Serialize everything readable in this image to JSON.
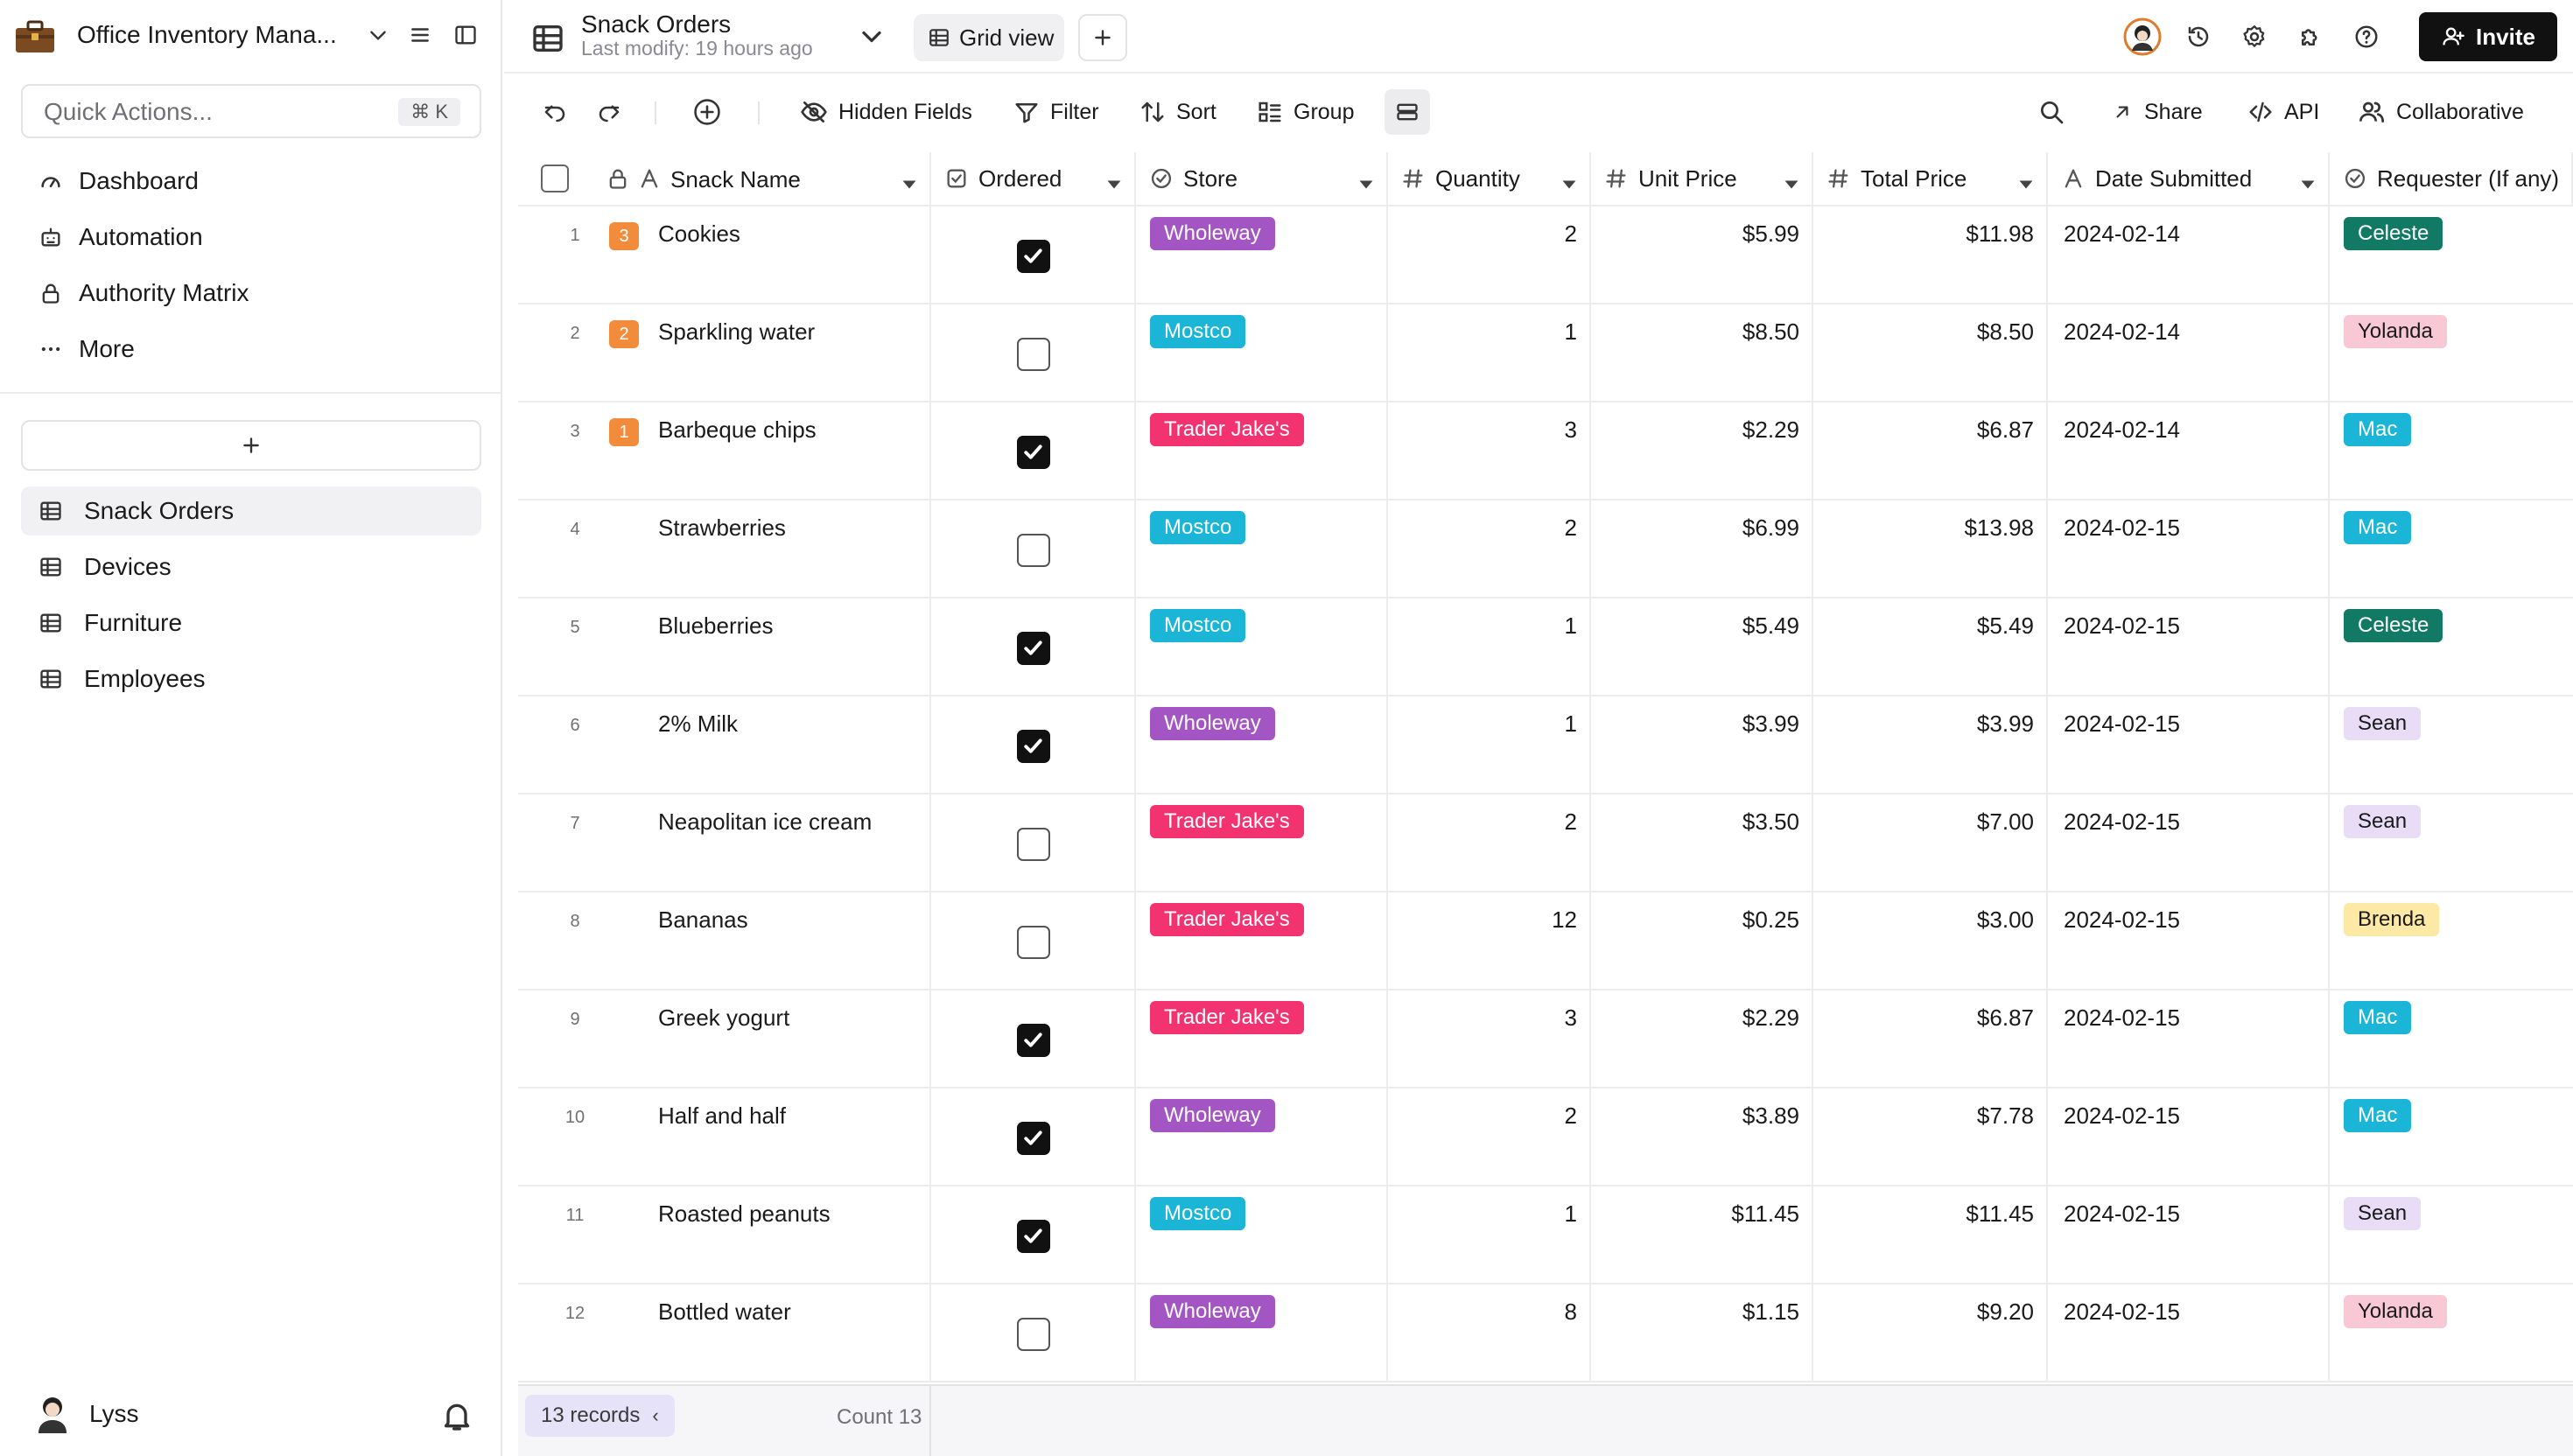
{
  "sidebar": {
    "app_title": "Office Inventory Mana...",
    "quick_actions": {
      "placeholder": "Quick Actions...",
      "shortcut": "⌘ K"
    },
    "nav": [
      {
        "label": "Dashboard",
        "icon": "dashboard-gauge-icon"
      },
      {
        "label": "Automation",
        "icon": "robot-icon"
      },
      {
        "label": "Authority Matrix",
        "icon": "lock-icon"
      },
      {
        "label": "More",
        "icon": "more-dots-icon"
      }
    ],
    "tables": [
      {
        "label": "Snack Orders",
        "active": true
      },
      {
        "label": "Devices",
        "active": false
      },
      {
        "label": "Furniture",
        "active": false
      },
      {
        "label": "Employees",
        "active": false
      }
    ],
    "user": {
      "name": "Lyss"
    }
  },
  "topbar": {
    "table_title": "Snack Orders",
    "last_modified": "Last modify: 19 hours ago",
    "view_label": "Grid view",
    "invite_label": "Invite"
  },
  "toolbar": {
    "hidden_fields": "Hidden Fields",
    "filter": "Filter",
    "sort": "Sort",
    "group": "Group",
    "share": "Share",
    "api": "API",
    "collaborative": "Collaborative"
  },
  "grid": {
    "columns": [
      {
        "key": "name",
        "label": "Snack Name"
      },
      {
        "key": "ordered",
        "label": "Ordered"
      },
      {
        "key": "store",
        "label": "Store"
      },
      {
        "key": "quantity",
        "label": "Quantity"
      },
      {
        "key": "unit_price",
        "label": "Unit Price"
      },
      {
        "key": "total_price",
        "label": "Total Price"
      },
      {
        "key": "date",
        "label": "Date Submitted"
      },
      {
        "key": "requester",
        "label": "Requester (If any)"
      }
    ],
    "store_colors": {
      "Wholeway": "#a455c4",
      "Mostco": "#1bb5d8",
      "Trader Jake's": "#f2336f"
    },
    "requester_colors": {
      "Celeste": {
        "bg": "#127a64",
        "fg": "#ffffff"
      },
      "Yolanda": {
        "bg": "#f8c9d5",
        "fg": "#1a1a1a"
      },
      "Mac": {
        "bg": "#1bb5d8",
        "fg": "#ffffff"
      },
      "Sean": {
        "bg": "#e8dcf7",
        "fg": "#1a1a1a"
      },
      "Brenda": {
        "bg": "#fde9a6",
        "fg": "#1a1a1a"
      }
    },
    "rows": [
      {
        "num": "1",
        "priority": "3",
        "name": "Cookies",
        "ordered": true,
        "store": "Wholeway",
        "quantity": "2",
        "unit_price": "$5.99",
        "total_price": "$11.98",
        "date": "2024-02-14",
        "requester": "Celeste"
      },
      {
        "num": "2",
        "priority": "2",
        "name": "Sparkling water",
        "ordered": false,
        "store": "Mostco",
        "quantity": "1",
        "unit_price": "$8.50",
        "total_price": "$8.50",
        "date": "2024-02-14",
        "requester": "Yolanda"
      },
      {
        "num": "3",
        "priority": "1",
        "name": "Barbeque chips",
        "ordered": true,
        "store": "Trader Jake's",
        "quantity": "3",
        "unit_price": "$2.29",
        "total_price": "$6.87",
        "date": "2024-02-14",
        "requester": "Mac"
      },
      {
        "num": "4",
        "priority": "",
        "name": "Strawberries",
        "ordered": false,
        "store": "Mostco",
        "quantity": "2",
        "unit_price": "$6.99",
        "total_price": "$13.98",
        "date": "2024-02-15",
        "requester": "Mac"
      },
      {
        "num": "5",
        "priority": "",
        "name": "Blueberries",
        "ordered": true,
        "store": "Mostco",
        "quantity": "1",
        "unit_price": "$5.49",
        "total_price": "$5.49",
        "date": "2024-02-15",
        "requester": "Celeste"
      },
      {
        "num": "6",
        "priority": "",
        "name": "2% Milk",
        "ordered": true,
        "store": "Wholeway",
        "quantity": "1",
        "unit_price": "$3.99",
        "total_price": "$3.99",
        "date": "2024-02-15",
        "requester": "Sean"
      },
      {
        "num": "7",
        "priority": "",
        "name": "Neapolitan ice cream",
        "ordered": false,
        "store": "Trader Jake's",
        "quantity": "2",
        "unit_price": "$3.50",
        "total_price": "$7.00",
        "date": "2024-02-15",
        "requester": "Sean"
      },
      {
        "num": "8",
        "priority": "",
        "name": "Bananas",
        "ordered": false,
        "store": "Trader Jake's",
        "quantity": "12",
        "unit_price": "$0.25",
        "total_price": "$3.00",
        "date": "2024-02-15",
        "requester": "Brenda"
      },
      {
        "num": "9",
        "priority": "",
        "name": "Greek yogurt",
        "ordered": true,
        "store": "Trader Jake's",
        "quantity": "3",
        "unit_price": "$2.29",
        "total_price": "$6.87",
        "date": "2024-02-15",
        "requester": "Mac"
      },
      {
        "num": "10",
        "priority": "",
        "name": "Half and half",
        "ordered": true,
        "store": "Wholeway",
        "quantity": "2",
        "unit_price": "$3.89",
        "total_price": "$7.78",
        "date": "2024-02-15",
        "requester": "Mac"
      },
      {
        "num": "11",
        "priority": "",
        "name": "Roasted peanuts",
        "ordered": true,
        "store": "Mostco",
        "quantity": "1",
        "unit_price": "$11.45",
        "total_price": "$11.45",
        "date": "2024-02-15",
        "requester": "Sean"
      },
      {
        "num": "12",
        "priority": "",
        "name": "Bottled water",
        "ordered": false,
        "store": "Wholeway",
        "quantity": "8",
        "unit_price": "$1.15",
        "total_price": "$9.20",
        "date": "2024-02-15",
        "requester": "Yolanda"
      }
    ]
  },
  "footer": {
    "records": "13 records",
    "count": "Count 13"
  }
}
